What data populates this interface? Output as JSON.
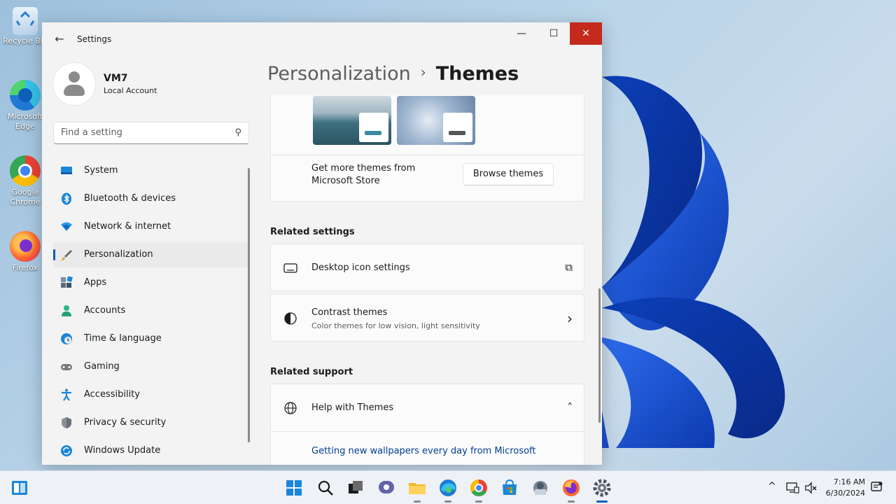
{
  "desktop": {
    "icons": [
      {
        "label": "Recycle Bin",
        "icon": "recycle-bin-icon"
      },
      {
        "label": "Microsoft Edge",
        "icon": "edge-icon"
      },
      {
        "label": "Google Chrome",
        "icon": "chrome-icon"
      },
      {
        "label": "Firefox",
        "icon": "firefox-icon"
      }
    ]
  },
  "window": {
    "title": "Settings",
    "back_icon": "←",
    "minimize_icon": "—",
    "maximize_icon": "☐",
    "close_icon": "✕"
  },
  "profile": {
    "name": "VM7",
    "account_type": "Local Account"
  },
  "search": {
    "placeholder": "Find a setting",
    "icon": "⚲"
  },
  "nav": {
    "items": [
      {
        "label": "System",
        "icon": "system-icon"
      },
      {
        "label": "Bluetooth & devices",
        "icon": "bluetooth-icon"
      },
      {
        "label": "Network & internet",
        "icon": "network-icon"
      },
      {
        "label": "Personalization",
        "icon": "personalization-brush-icon",
        "selected": true
      },
      {
        "label": "Apps",
        "icon": "apps-icon"
      },
      {
        "label": "Accounts",
        "icon": "accounts-icon"
      },
      {
        "label": "Time & language",
        "icon": "time-language-icon"
      },
      {
        "label": "Gaming",
        "icon": "gaming-icon"
      },
      {
        "label": "Accessibility",
        "icon": "accessibility-icon"
      },
      {
        "label": "Privacy & security",
        "icon": "shield-icon"
      },
      {
        "label": "Windows Update",
        "icon": "windows-update-icon"
      }
    ]
  },
  "breadcrumb": {
    "parent": "Personalization",
    "separator": "›",
    "current": "Themes"
  },
  "themes": {
    "store_text_line1": "Get more themes from",
    "store_text_line2": "Microsoft Store",
    "browse_button": "Browse themes"
  },
  "related_settings": {
    "heading": "Related settings",
    "desktop_icons": {
      "title": "Desktop icon settings",
      "action_icon": "⧉"
    },
    "contrast": {
      "title": "Contrast themes",
      "subtitle": "Color themes for low vision, light sensitivity",
      "chevron": "›"
    }
  },
  "related_support": {
    "heading": "Related support",
    "help": {
      "title": "Help with Themes",
      "chevron": "˄"
    },
    "link": "Getting new wallpapers every day from Microsoft"
  },
  "taskbar": {
    "clock_time": "7:16 AM",
    "clock_date": "6/30/2024",
    "tray_chevron": "^"
  },
  "colors": {
    "accent": "#005fb8",
    "close_red": "#c42b1c",
    "link": "#003e92"
  }
}
